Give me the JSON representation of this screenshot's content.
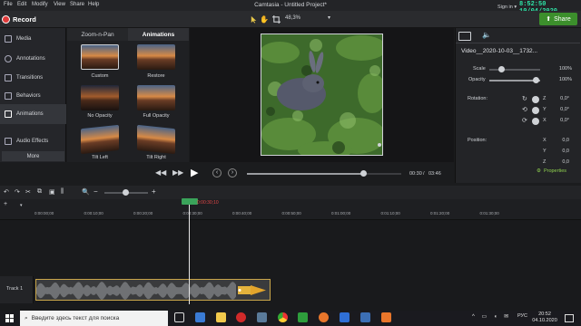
{
  "menubar": {
    "items": [
      "File",
      "Edit",
      "Modify",
      "View",
      "Share",
      "Help"
    ],
    "title": "Camtasia - Untitled Project*",
    "sign_in": "Sign in ▾",
    "clock": "8:52:50 10/04/2020"
  },
  "toolbar": {
    "record_label": "Record",
    "zoom": "48,3%",
    "share_label": "Share"
  },
  "sidebar": {
    "items": [
      {
        "label": "Media",
        "icon": "media-icon"
      },
      {
        "label": "Annotations",
        "icon": "annotations-icon"
      },
      {
        "label": "Transitions",
        "icon": "transitions-icon"
      },
      {
        "label": "Behaviors",
        "icon": "behaviors-icon"
      },
      {
        "label": "Animations",
        "icon": "animations-icon",
        "active": true
      },
      {
        "label": "Audio Effects",
        "icon": "audio-effects-icon"
      }
    ],
    "more_label": "More"
  },
  "library": {
    "tabs": [
      "Zoom-n-Pan",
      "Animations"
    ],
    "active_tab": "Animations",
    "items": [
      "Custom",
      "Restore",
      "No Opacity",
      "Full Opacity",
      "Tilt Left",
      "Tilt Right"
    ]
  },
  "playback": {
    "current_time": "00:30",
    "total_time": "03:46",
    "progress": 0.75
  },
  "properties": {
    "clip_name": "Video__2020-10-03__1732...",
    "scale_label": "Scale",
    "scale_value": "100%",
    "opacity_label": "Opacity",
    "opacity_value": "100%",
    "rotation_label": "Rotation:",
    "rotation": [
      {
        "axis": "Z",
        "value": "0,0°"
      },
      {
        "axis": "Y",
        "value": "0,0°"
      },
      {
        "axis": "X",
        "value": "0,0°"
      }
    ],
    "position_label": "Position:",
    "position": [
      {
        "axis": "X",
        "value": "0,0"
      },
      {
        "axis": "Y",
        "value": "0,0"
      },
      {
        "axis": "Z",
        "value": "0,0"
      }
    ],
    "button_label": "Properties"
  },
  "timeline": {
    "playhead_time": "0:00:30;10",
    "ticks": [
      "0:00:00;00",
      "0:00:10;00",
      "0:00:20;00",
      "0:00:30;00",
      "0:00:40;00",
      "0:00:50;00",
      "0:01:00;00",
      "0:01:10;00",
      "0:01:20;00",
      "0:01:30;00"
    ],
    "track_label": "Track 1"
  },
  "taskbar": {
    "search_placeholder": "Введите здесь текст для поиска",
    "lang": "РУС",
    "time": "20:52",
    "date": "04.10.2020"
  },
  "colors": {
    "accent_green": "#3c8f2c",
    "record_red": "#e03a3a",
    "clip_border": "#c9a64a",
    "clock_green": "#2ee6a8"
  }
}
